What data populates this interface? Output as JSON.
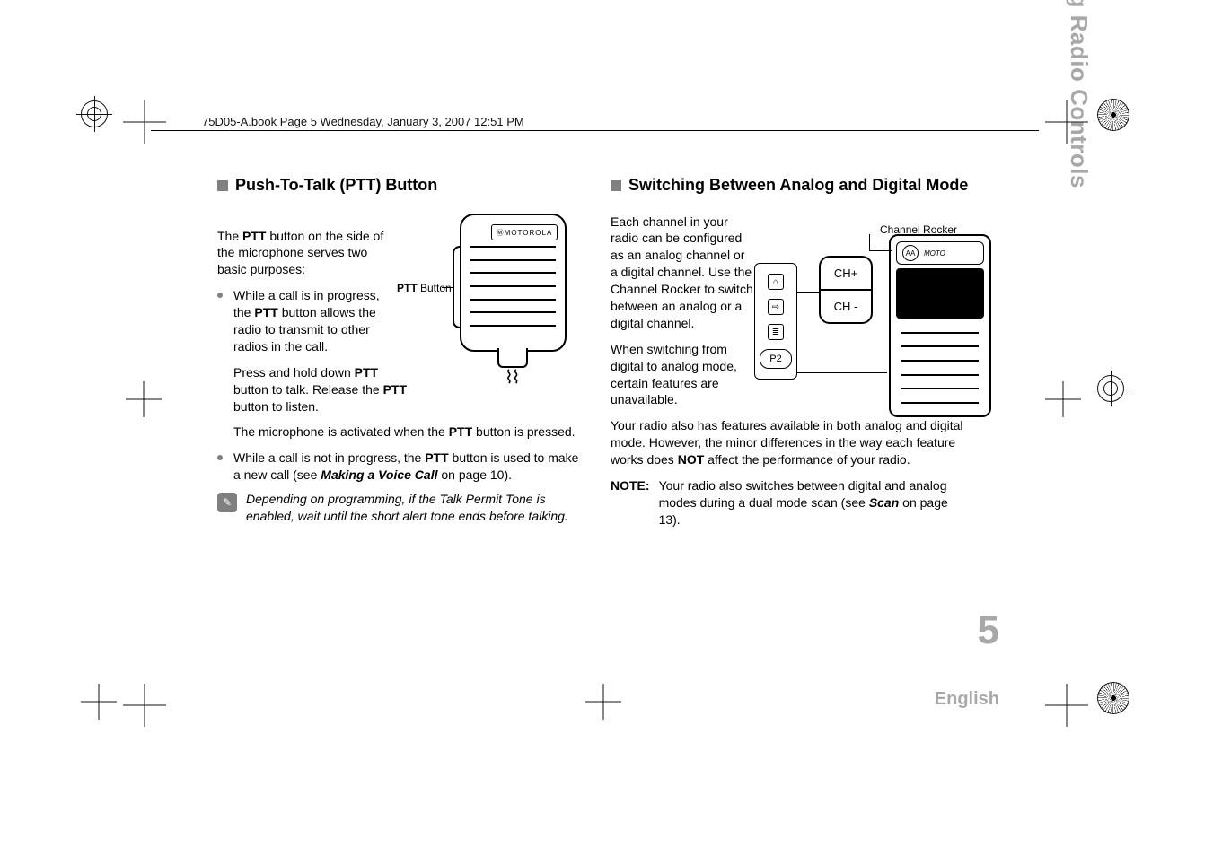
{
  "header": {
    "running_head": "75D05-A.book  Page 5  Wednesday, January 3, 2007  12:51 PM"
  },
  "side": {
    "section_title": "Identifying Radio Controls",
    "page_number": "5",
    "language": "English"
  },
  "left": {
    "heading": "Push-To-Talk (PTT) Button",
    "intro_a": "The ",
    "intro_b": "PTT",
    "intro_c": " button on the side of the microphone serves two basic purposes:",
    "b1_a": "While a call is in progress, the ",
    "b1_b": "PTT",
    "b1_c": " button allows the radio to transmit to other radios in the call.",
    "press_a": "Press and hold down ",
    "press_b": "PTT",
    "press_c": " button to talk. Release the ",
    "press_d": "PTT",
    "press_e": " button to listen.",
    "mic_a": "The microphone is activated when the ",
    "mic_b": "PTT",
    "mic_c": " button is pressed.",
    "b2_a": "While a call is not in progress, the ",
    "b2_b": "PTT",
    "b2_c": " button is used to make a new call (see ",
    "b2_d": "Making a Voice Call",
    "b2_e": " on page 10).",
    "note": "Depending on programming, if the Talk Permit Tone is enabled, wait until the short alert tone ends before talking.",
    "fig_label_a": "PTT",
    "fig_label_b": " Button",
    "logo": "MOTOROLA"
  },
  "right": {
    "heading": "Switching Between Analog and Digital Mode",
    "p1": "Each channel in your radio can be configured as an analog channel or a digital channel. Use the Channel Rocker to switch between an analog or a digital channel.",
    "p2": "When switching from digital to analog mode, certain features are unavailable.",
    "p3_a": "Your radio also has features available in both analog and digital mode. However, the minor differences in the way each feature works does ",
    "p3_b": "NOT",
    "p3_c": " affect the performance of your radio.",
    "note_label": "NOTE:",
    "note_a": "Your radio also switches between digital and analog modes during a dual mode scan (see ",
    "note_b": "Scan",
    "note_c": " on page 13).",
    "fig": {
      "channel_rocker_label": "Channel Rocker",
      "ch_plus": "CH+",
      "ch_minus": "CH -",
      "p2_btn": "P2",
      "aa": "AA",
      "brand": "MOTO"
    }
  }
}
